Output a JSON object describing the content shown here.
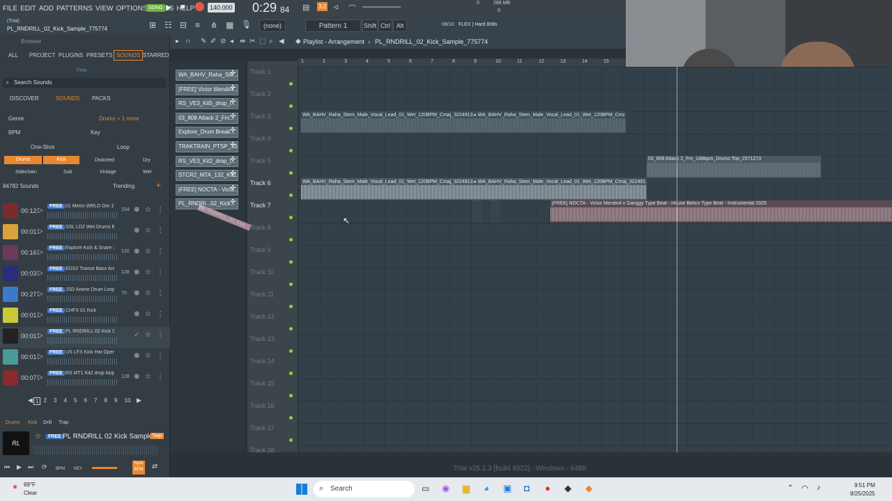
{
  "menu": [
    "FILE",
    "EDIT",
    "ADD",
    "PATTERNS",
    "VIEW",
    "OPTIONS",
    "TOOLS",
    "HELP"
  ],
  "song_label": "SONG",
  "tempo": "140.000",
  "time": "0:29",
  "time_small": "84",
  "time_sig": "3:2",
  "mem": {
    "top": "0",
    "mb": "288 MB",
    "bottom": "0"
  },
  "project": {
    "line1": "(Trial)",
    "line2": "PL_RNDRILL_02_Kick_Sample_775774"
  },
  "snap": "(none)",
  "pattern": "Pattern 1",
  "keys": [
    "Shift",
    "Ctrl",
    "Alt"
  ],
  "flex": {
    "num": "08/10",
    "name": "FLEX | Hard 808s"
  },
  "breadcrumb": "Playlist - Arrangement",
  "breadcrumb_file": "PL_RNDRILL_02_Kick_Sample_775774",
  "browser": {
    "title": "Browser",
    "tabs": [
      "ALL",
      "PROJECT",
      "PLUGINS",
      "PRESETS",
      "SOUNDS",
      "STARRED"
    ],
    "free_btn": "Free",
    "search_placeholder": "Search Sounds",
    "subtabs": [
      "DISCOVER",
      "SOUNDS",
      "PACKS"
    ],
    "filters": {
      "genre": "Genre",
      "drums": "Drums + 1 more",
      "bpm": "BPM",
      "key": "Key",
      "oneshot": "One-Shot",
      "loop": "Loop"
    },
    "chips": [
      "Drums",
      "Kick",
      "Distorted",
      "Dry"
    ],
    "chips2": [
      "Sidechain",
      "Sub",
      "Vintage",
      "Wet"
    ],
    "count": "84782 Sounds",
    "sort": "Trending",
    "rows": [
      {
        "dur": "00:12",
        "name": "01 Metro WRLD Om 154...",
        "bpm": "154",
        "free": "FREE",
        "color": "#7a2b2b"
      },
      {
        "dur": "00:01",
        "name": "SSL LD2 Wet Drums Bass...",
        "bpm": "",
        "free": "FREE",
        "color": "#d9a23a"
      },
      {
        "dur": "00:16",
        "name": "Explore Kick & Snare 120...",
        "bpm": "120",
        "free": "FREE",
        "color": "#6b3a5a"
      },
      {
        "dur": "00:03",
        "name": "EDS2 Trance Bass And Ki...",
        "bpm": "128",
        "free": "FREE",
        "color": "#2a2e7a"
      },
      {
        "dur": "00:27",
        "name": "JSD Anime Drum Loop 7...",
        "bpm": "70",
        "free": "FREE",
        "color": "#3a7ac9"
      },
      {
        "dur": "00:01",
        "name": "CHFX 01 Kick",
        "bpm": "",
        "free": "FREE",
        "color": "#c9c93a"
      },
      {
        "dur": "00:01",
        "name": "PL RNDRILL 02 Kick Sam...",
        "bpm": "",
        "free": "FREE",
        "color": "#222222"
      },
      {
        "dur": "00:01",
        "name": "US LFS Kick Hat Open agg",
        "bpm": "",
        "free": "FREE",
        "color": "#4a9a9a"
      },
      {
        "dur": "00:07",
        "name": "RS MT1 Kit2 drop loop kil...",
        "bpm": "128",
        "free": "FREE",
        "color": "#8a2a2a"
      }
    ],
    "pages": [
      "1",
      "2",
      "3",
      "4",
      "5",
      "6",
      "7",
      "8",
      "9",
      "10"
    ],
    "tags": [
      "Drums",
      "Kick",
      "Drill",
      "Trap"
    ],
    "preview_free": "FREE",
    "preview_name": "PL RNDRILL 02 Kick Sample",
    "preview_tag": "Tags",
    "preview_bpm": "BPM",
    "preview_key": "KEY",
    "sync": "Sync BPM"
  },
  "channels": [
    "WA_BAHV_Raha_Ste...",
    "[FREE] Victor Mendivi...",
    "RS_VE3_Kit5_drop_l...",
    "03_808 Attack 2_Fm...",
    "Explore_Drum Break...",
    "TRAKTRAIN_PTSP_33...",
    "RS_VE3_Kit2_drop_l...",
    "STCR2_MTA_132_Kit2...",
    "[FREE] NOCTA - Victo...",
    "PL_RNDRI...02_Kick..."
  ],
  "drag_ghost": "PL_RNDRILL_02_Kick...",
  "ruler": [
    "1",
    "2",
    "3",
    "4",
    "5",
    "6",
    "7",
    "8",
    "9",
    "10",
    "11",
    "12",
    "13",
    "14",
    "15"
  ],
  "tracks": [
    "Track 1",
    "Track 2",
    "Track 3",
    "Track 4",
    "Track 5",
    "Track 6",
    "Track 7",
    "Track 8",
    "Track 9",
    "Track 10",
    "Track 11",
    "Track 12",
    "Track 13",
    "Track 14",
    "Track 15",
    "Track 16",
    "Track 17",
    "Track 18"
  ],
  "clips": {
    "t3": "WA_BAHV_Raha_Stem_Male_Vocal_Lead_01_Wet_120BPM_Cmaj_3224913 ▸ WA_BAHV_Raha_Stem_Male_Vocal_Lead_01_Wet_120BPM_Cmaj",
    "t5": "03_808 Attack 2_Fm_148bpm_Drums Top_2571273",
    "t6": "WA_BAHV_Raha_Stem_Male_Vocal_Lead_01_Wet_120BPM_Cmaj_3224913 ▸ WA_BAHV_Raha_Stem_Male_Vocal_Lead_01_Wet_120BPM_Cmaj_3224913",
    "t7": "[FREE] NOCTA - Victor Mendivil x Ganggy Type Beat - House Belico Type Beat - Instrumental 2025"
  },
  "status": "Trial v25.1.3 [build 4922] - Windows - 64Bit",
  "taskbar": {
    "temp": "69°F",
    "weather": "Clear",
    "search": "Search",
    "time": "9:51 PM",
    "date": "8/25/2025"
  }
}
